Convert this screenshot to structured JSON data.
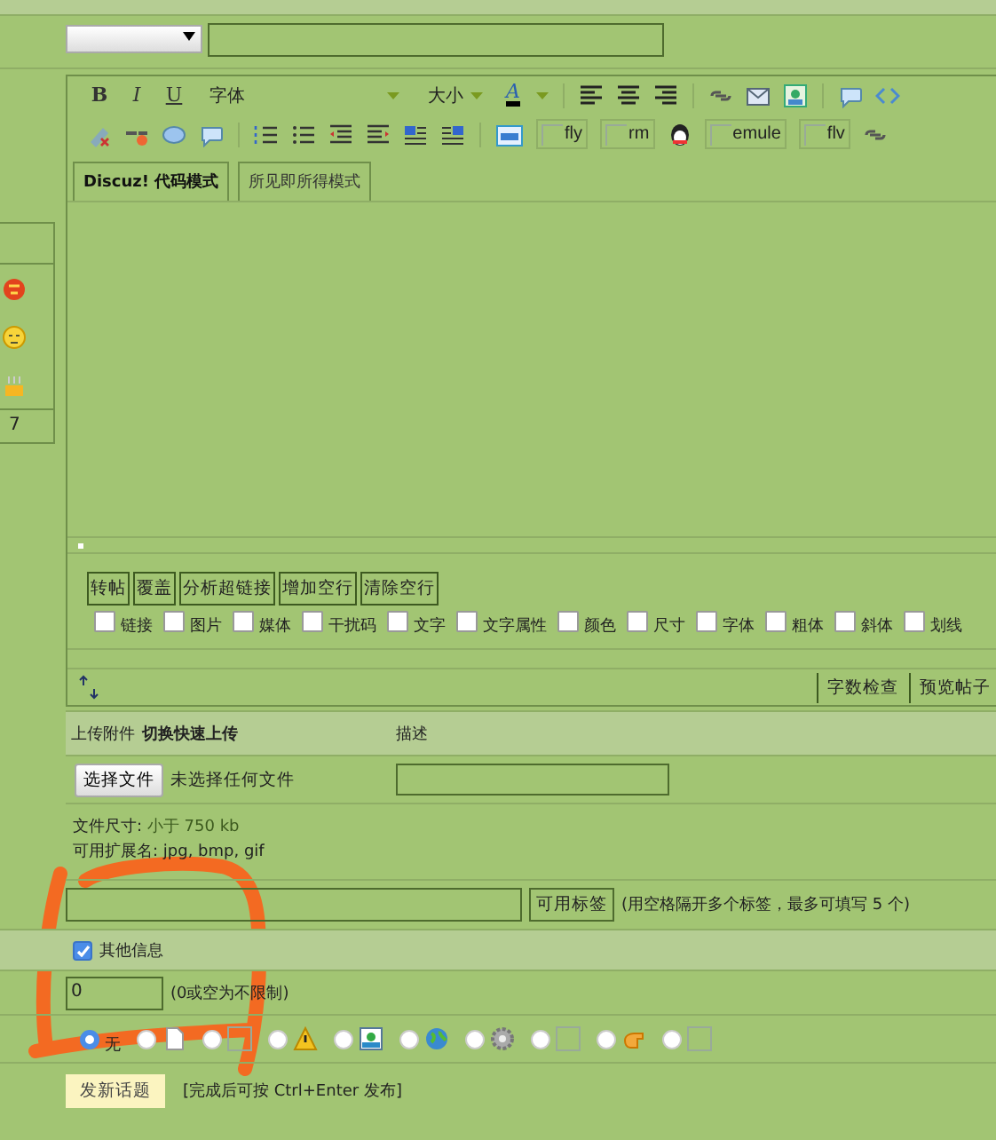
{
  "sidebar": {
    "count": "7"
  },
  "editor": {
    "toolbar": {
      "format_buttons": [
        "B",
        "I",
        "U"
      ],
      "font_label": "字体",
      "size_label": "大小",
      "color_button": "A",
      "media_buttons": [
        {
          "label": "fly"
        },
        {
          "label": "rm"
        },
        {
          "label": "emule"
        },
        {
          "label": "flv"
        }
      ]
    },
    "mode_tabs": [
      {
        "label": "Discuz! 代码模式",
        "selected": true
      },
      {
        "label": "所见即所得模式",
        "selected": false
      }
    ],
    "actions": [
      "转帖",
      "覆盖",
      "分析超链接",
      "增加空行",
      "清除空行"
    ],
    "filters": [
      {
        "label": "链接",
        "checked": false
      },
      {
        "label": "图片",
        "checked": false
      },
      {
        "label": "媒体",
        "checked": false
      },
      {
        "label": "干扰码",
        "checked": false
      },
      {
        "label": "文字",
        "checked": false
      },
      {
        "label": "文字属性",
        "checked": false
      },
      {
        "label": "颜色",
        "checked": false
      },
      {
        "label": "尺寸",
        "checked": false
      },
      {
        "label": "字体",
        "checked": false
      },
      {
        "label": "粗体",
        "checked": false
      },
      {
        "label": "斜体",
        "checked": false
      },
      {
        "label": "划线",
        "checked": false
      }
    ],
    "footer_buttons": [
      "字数检查",
      "预览帖子"
    ]
  },
  "attachments": {
    "title": "上传附件",
    "quick_link": "切换快速上传",
    "description_header": "描述",
    "file_button": "选择文件",
    "file_status": "未选择任何文件",
    "size_label": "文件尺寸:",
    "size_value": "小于 750 kb",
    "extensions": "可用扩展名: jpg, bmp, gif"
  },
  "tags": {
    "button": "可用标签",
    "hint": "(用空格隔开多个标签，最多可填写 5 个)"
  },
  "other_info": {
    "label": "其他信息",
    "checked": true
  },
  "limit": {
    "value": "0",
    "hint": "(0或空为不限制)"
  },
  "post_icons": [
    {
      "kind": "none",
      "label": "无",
      "selected": true
    },
    {
      "kind": "page",
      "selected": false
    },
    {
      "kind": "broken",
      "selected": false
    },
    {
      "kind": "warning",
      "selected": false
    },
    {
      "kind": "picture",
      "selected": false
    },
    {
      "kind": "globe",
      "selected": false
    },
    {
      "kind": "gear",
      "selected": false
    },
    {
      "kind": "broken",
      "selected": false
    },
    {
      "kind": "hand",
      "selected": false
    },
    {
      "kind": "broken",
      "selected": false
    }
  ],
  "submit": {
    "button": "发新话题",
    "hint": "[完成后可按 Ctrl+Enter 发布]"
  }
}
